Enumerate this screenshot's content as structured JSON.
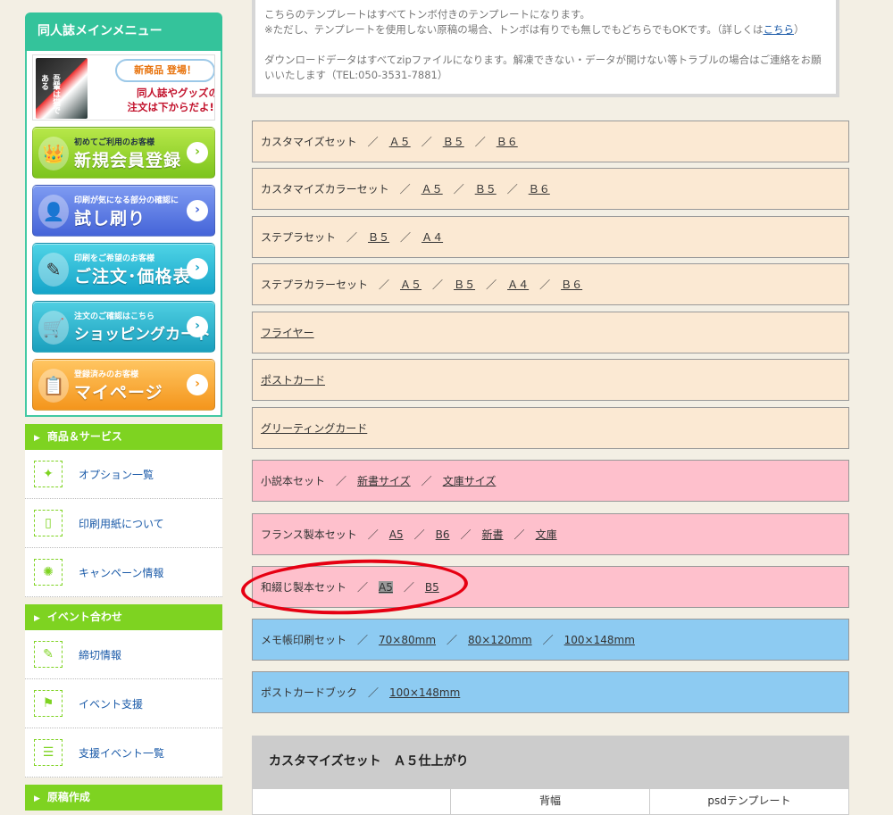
{
  "sidebar": {
    "menu_title": "同人誌メインメニュー",
    "promo": {
      "book_text": "吾輩は猫である",
      "bubble": "新商品 登場！",
      "line1": "同人誌やグッズの",
      "line2": "注文は下からだよ!!"
    },
    "buttons": [
      {
        "small": "初めてご利用のお客様",
        "big": "新規会員登録",
        "icon": "👑"
      },
      {
        "small": "印刷が気になる部分の確認に",
        "big": "試し刷り",
        "icon": "👤"
      },
      {
        "small": "印刷をご希望のお客様",
        "big": "ご注文･価格表",
        "icon": "✎"
      },
      {
        "small": "注文のご確認はこちら",
        "big": "ショッピングカート",
        "icon": "🛒"
      },
      {
        "small": "登録済みのお客様",
        "big": "マイページ",
        "icon": "📋"
      }
    ],
    "arrow": "›",
    "sections": [
      {
        "title": "商品＆サービス",
        "links": [
          "オプション一覧",
          "印刷用紙について",
          "キャンペーン情報"
        ]
      },
      {
        "title": "イベント合わせ",
        "links": [
          "締切情報",
          "イベント支援",
          "支援イベント一覧"
        ]
      },
      {
        "title": "原稿作成",
        "links": []
      }
    ],
    "section_marker": "▶"
  },
  "notice": {
    "line1": "こちらのテンプレートはすべてトンボ付きのテンプレートになります。",
    "line2_pre": "※ただし、テンプレートを使用しない原稿の場合、トンボは有りでも無しでもどちらでもOKです。（詳しくは",
    "line2_link": "こちら",
    "line2_post": "）",
    "line3": "ダウンロードデータはすべてzipファイルになります。解凍できない・データが開けない等トラブルの場合はご連絡をお願",
    "line4": "いいたします（TEL:050-3531-7881）"
  },
  "rows": [
    {
      "label": "カスタマイズセット",
      "links": [
        "Ａ５",
        "Ｂ５",
        "Ｂ６"
      ]
    },
    {
      "label": "カスタマイズカラーセット",
      "links": [
        "Ａ５",
        "Ｂ５",
        "Ｂ６"
      ]
    },
    {
      "label": "ステプラセット",
      "links": [
        "Ｂ５",
        "Ａ４"
      ]
    },
    {
      "label": "ステプラカラーセット",
      "links": [
        "Ａ５",
        "Ｂ５",
        "Ａ４",
        "Ｂ６"
      ]
    },
    {
      "label": "フライヤー"
    },
    {
      "label": "ポストカード"
    },
    {
      "label": "グリーティングカード"
    },
    {
      "label": "小説本セット",
      "links": [
        "新書サイズ",
        "文庫サイズ"
      ]
    },
    {
      "label": "フランス製本セット",
      "links": [
        "A5",
        "B6",
        "新書",
        "文庫"
      ]
    },
    {
      "label": "和綴じ製本セット",
      "links": [
        "A5",
        "B5"
      ]
    },
    {
      "label": "メモ帳印刷セット",
      "links": [
        "70×80mm",
        "80×120mm",
        "100×148mm"
      ]
    },
    {
      "label": "ポストカードブック",
      "links": [
        "100×148mm"
      ]
    }
  ],
  "separator": "／",
  "table": {
    "title": "カスタマイズセット　Ａ５仕上がり",
    "columns": [
      "",
      "背幅",
      "psdテンプレート"
    ]
  },
  "colors": {
    "tan": "#fbe9d3",
    "pink": "#fec0cc",
    "blue": "#8dcbf2",
    "circle": "#e60012",
    "section": "#7ed321"
  }
}
